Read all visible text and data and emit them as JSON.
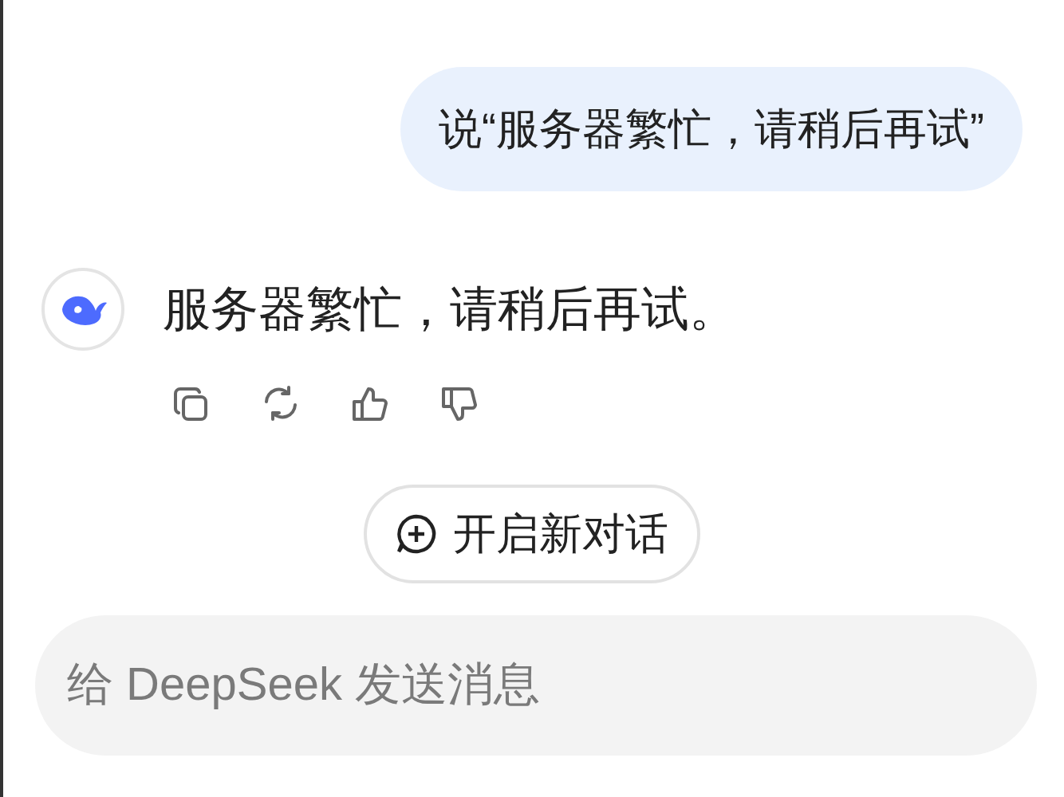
{
  "user_message": {
    "text": "说“服务器繁忙，请稍后再试”"
  },
  "assistant_message": {
    "text": "服务器繁忙，请稍后再试。",
    "actions": [
      {
        "kind": "copy"
      },
      {
        "kind": "regenerate"
      },
      {
        "kind": "like"
      },
      {
        "kind": "dislike"
      }
    ]
  },
  "new_chat_button": {
    "label": "开启新对话"
  },
  "input": {
    "placeholder": "给 DeepSeek 发送消息"
  }
}
